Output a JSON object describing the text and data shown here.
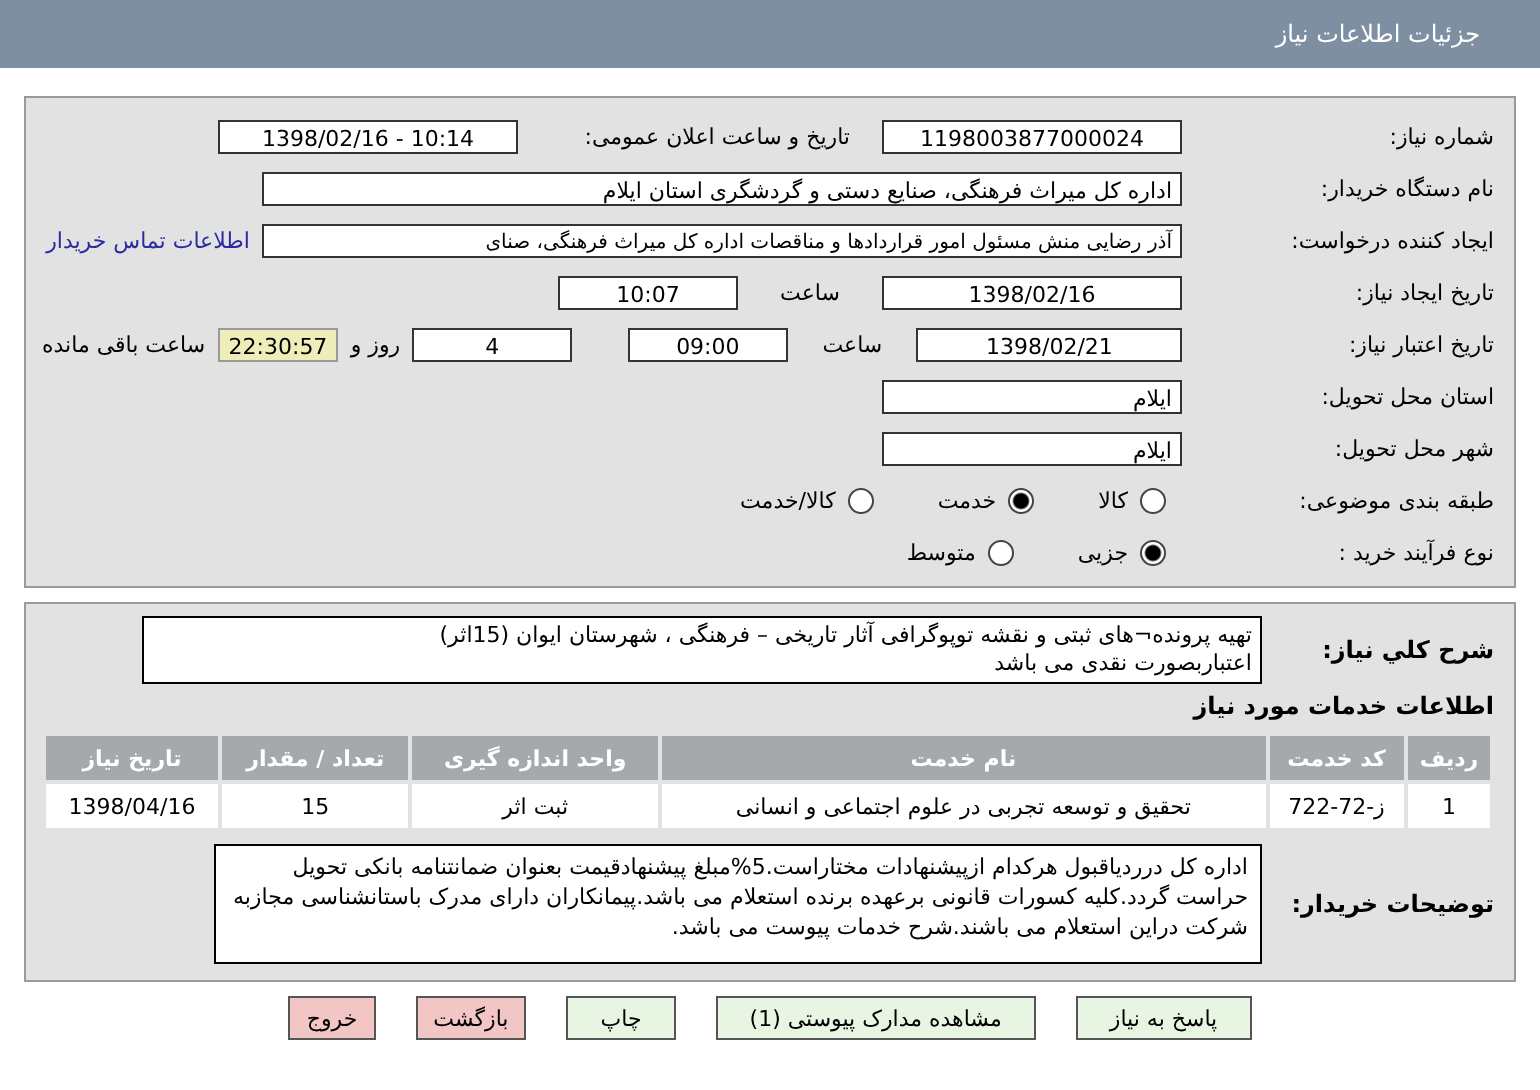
{
  "header": {
    "title": "جزئیات اطلاعات نیاز"
  },
  "need_number": {
    "label": "شماره نیاز:",
    "value": "1198003877000024"
  },
  "announce": {
    "label": "تاریخ و ساعت اعلان عمومی:",
    "value": "1398/02/16 - 10:14"
  },
  "buyer_org": {
    "label": "نام دستگاه خریدار:",
    "value": "اداره کل میراث فرهنگی، صنایع دستی و گردشگری استان ایلام"
  },
  "requester": {
    "label": "ایجاد کننده درخواست:",
    "value": "آذر رضایی منش مسئول امور قراردادها و مناقصات اداره کل میراث فرهنگی، صنای",
    "link": "اطلاعات تماس خریدار"
  },
  "created": {
    "label": "تاریخ ایجاد نیاز:",
    "date": "1398/02/16",
    "time_label": "ساعت",
    "time": "10:07"
  },
  "validity": {
    "label": "تاریخ اعتبار نیاز:",
    "date": "1398/02/21",
    "time_label": "ساعت",
    "time": "09:00",
    "days": "4",
    "days_label": "روز و",
    "remaining": "22:30:57",
    "remaining_label": "ساعت باقی مانده"
  },
  "province": {
    "label": "استان محل تحویل:",
    "value": "ایلام"
  },
  "city": {
    "label": "شهر محل تحویل:",
    "value": "ایلام"
  },
  "category": {
    "label": "طبقه بندی موضوعی:",
    "options": [
      {
        "label": "کالا",
        "selected": false
      },
      {
        "label": "خدمت",
        "selected": true
      },
      {
        "label": "کالا/خدمت",
        "selected": false
      }
    ]
  },
  "process": {
    "label": "نوع فرآیند خرید :",
    "options": [
      {
        "label": "جزیی",
        "selected": true
      },
      {
        "label": "متوسط",
        "selected": false
      }
    ]
  },
  "description": {
    "label": "شرح کلي نياز:",
    "lines": [
      "تهیه پرونده¬های ثبتی و  نقشه توپوگرافی آثار تاریخی – فرهنگی ، شهرستان ایوان (15اثر)",
      "اعتباربصورت نقدی می باشد"
    ]
  },
  "services": {
    "title": "اطلاعات خدمات مورد نیاز",
    "columns": [
      "ردیف",
      "کد خدمت",
      "نام خدمت",
      "واحد اندازه گیری",
      "تعداد / مقدار",
      "تاریخ نیاز"
    ],
    "rows": [
      [
        "1",
        "ز-72-722",
        "تحقیق و توسعه تجربی در علوم اجتماعی و انسانی",
        "ثبت اثر",
        "15",
        "1398/04/16"
      ]
    ]
  },
  "notes": {
    "label": "توضیحات خریدار:",
    "text": "اداره کل درردیاقبول هرکدام ازپیشنهادات مختاراست.5%مبلغ پیشنهادقیمت بعنوان ضمانتنامه بانکی تحویل حراست گردد.کلیه کسورات قانونی برعهده برنده استعلام می باشد.پیمانکاران دارای مدرک باستانشناسی مجازبه شرکت دراین استعلام می باشند.شرح خدمات پیوست می باشد."
  },
  "buttons": [
    {
      "label": "پاسخ به نیاز",
      "kind": "normal"
    },
    {
      "label": "مشاهده مدارک پیوستی (1)",
      "kind": "normal"
    },
    {
      "label": "چاپ",
      "kind": "normal"
    },
    {
      "label": "بازگشت",
      "kind": "danger"
    },
    {
      "label": "خروج",
      "kind": "danger"
    }
  ]
}
